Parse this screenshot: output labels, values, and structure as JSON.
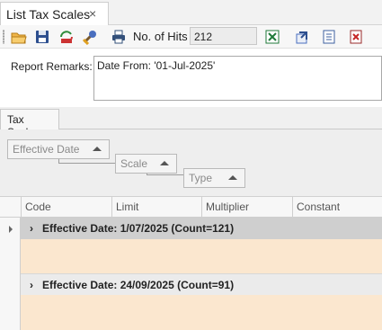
{
  "tab": {
    "title": "List Tax Scales",
    "close_glyph": "×"
  },
  "toolbar": {
    "icons": [
      "open-folder-icon",
      "save-icon",
      "refresh-icon",
      "wrench-icon",
      "print-icon",
      "export-excel-icon",
      "open-in-window-icon",
      "document-icon",
      "export-pdf-icon"
    ],
    "hits_label": "No. of Hits",
    "hits_value": "212"
  },
  "remarks": {
    "label": "Report Remarks:",
    "text": "Date From: '01-Jul-2025'"
  },
  "lower_tab": {
    "label": "Tax Scales"
  },
  "group_panel": {
    "chips": [
      "Effective Date",
      "Scale",
      "Type"
    ]
  },
  "grid": {
    "columns": [
      "Code",
      "Limit",
      "Multiplier",
      "Constant"
    ],
    "groups": [
      {
        "label": "Effective Date: 1/07/2025 (Count=121)"
      },
      {
        "label": "Effective Date: 24/09/2025 (Count=91)"
      }
    ]
  },
  "colors": {
    "group_header": "#cfcfcf",
    "group_row_alt": "#ebebeb",
    "row_fill": "#fbe7cf"
  }
}
